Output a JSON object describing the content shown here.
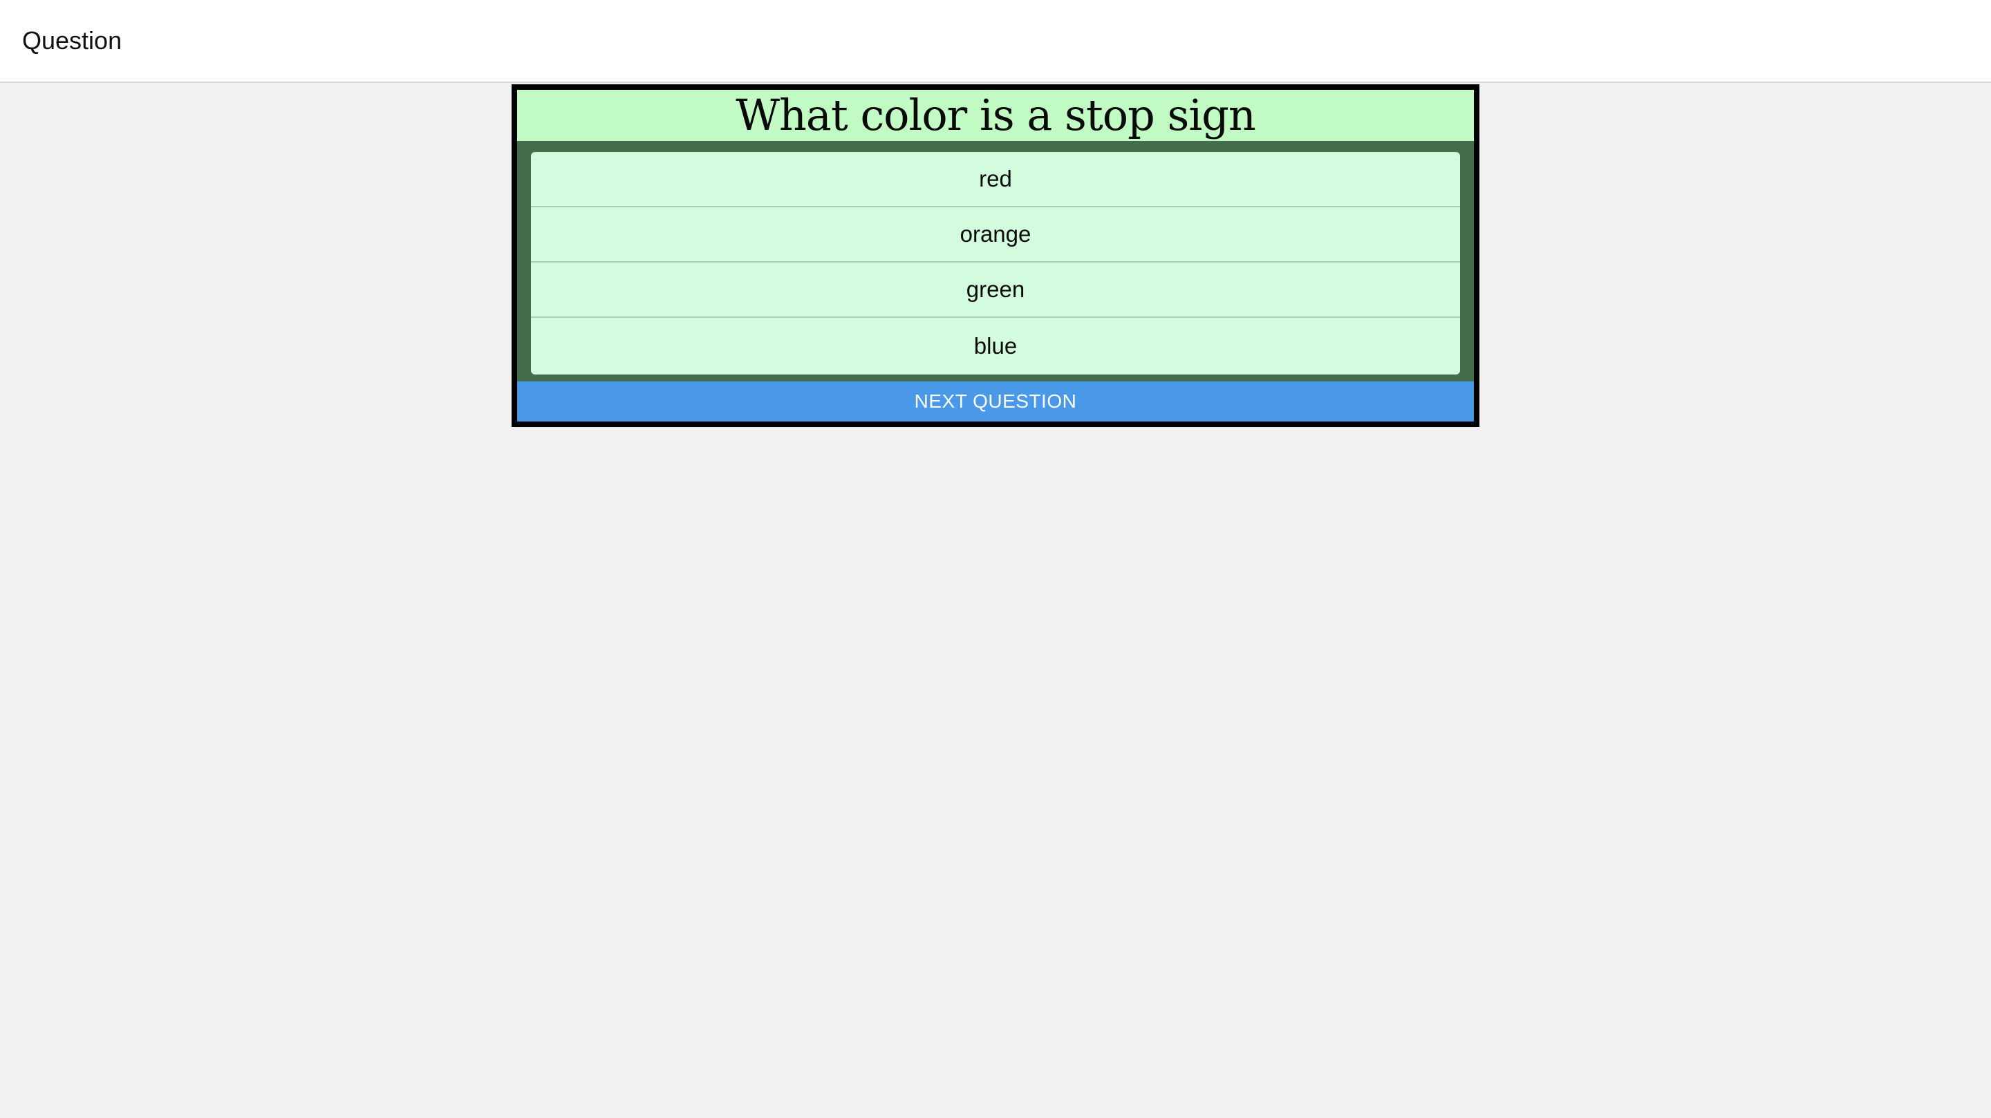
{
  "header": {
    "title": "Question"
  },
  "quiz": {
    "question": "What color is a stop sign",
    "answers": [
      {
        "label": "red"
      },
      {
        "label": "orange"
      },
      {
        "label": "green"
      },
      {
        "label": "blue"
      }
    ],
    "next_button_label": "NEXT QUESTION"
  },
  "colors": {
    "page_background": "#f1f1f1",
    "header_background": "#c1fac2",
    "panel_background": "#456b4d",
    "answer_background": "#d3fbdd",
    "button_background": "#4a98e8",
    "card_border": "#000000"
  }
}
